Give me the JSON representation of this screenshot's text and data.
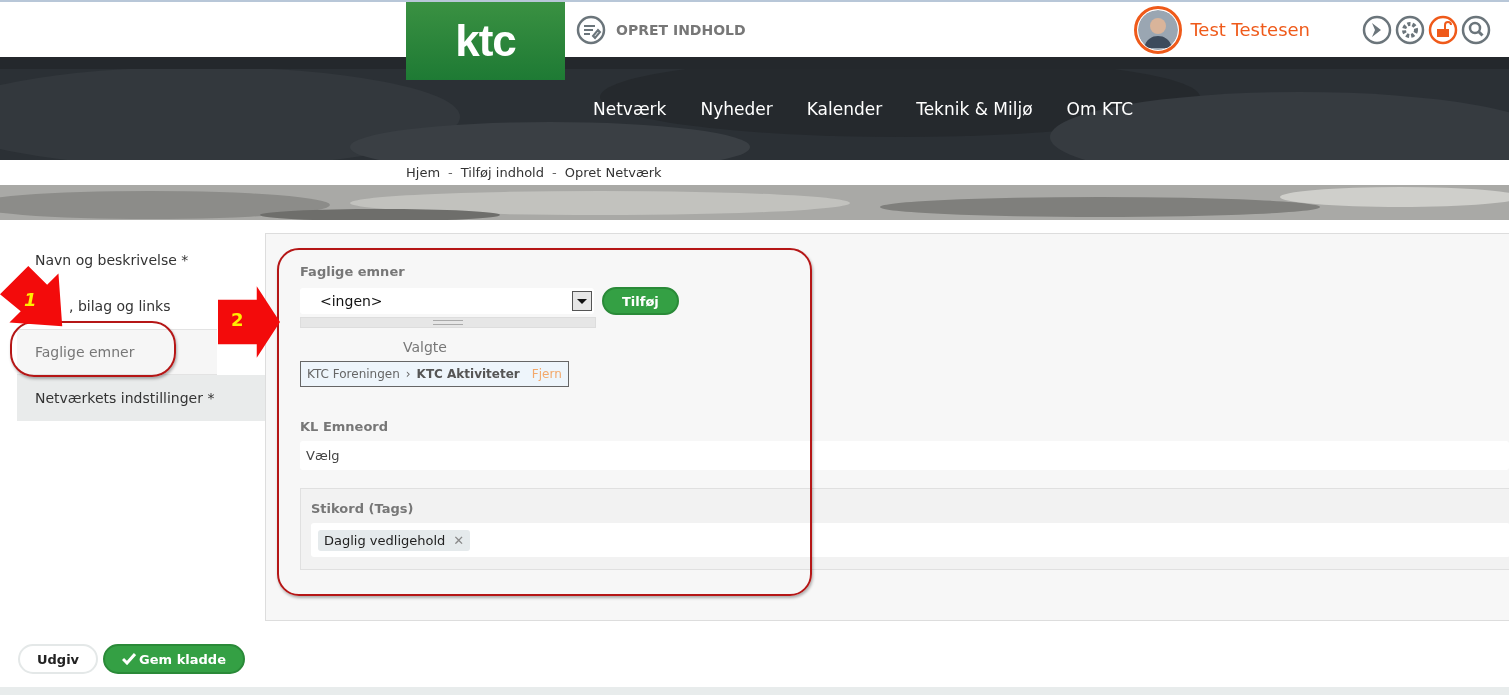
{
  "header": {
    "logo": "ktc",
    "create_link": "OPRET INDHOLD",
    "user_name": "Test Testesen"
  },
  "nav": [
    "Netværk",
    "Nyheder",
    "Kalender",
    "Teknik & Miljø",
    "Om KTC"
  ],
  "breadcrumb": [
    "Hjem",
    "Tilføj indhold",
    "Opret Netværk"
  ],
  "breadcrumb_separator": "-",
  "sidebar": [
    {
      "label": "Navn og beskrivelse *",
      "selected": false
    },
    {
      "label": ", bilag og links",
      "selected": false
    },
    {
      "label": "Faglige emner",
      "selected": true
    },
    {
      "label": "Netværkets indstillinger *",
      "selected": false
    }
  ],
  "subjects": {
    "title": "Faglige emner",
    "select_value": "<ingen>",
    "add_button": "Tilføj",
    "selected_title": "Valgte",
    "selected_items": [
      {
        "path": "KTC Foreningen",
        "separator": "›",
        "name": "KTC Aktiviteter",
        "remove": "Fjern"
      }
    ]
  },
  "kl_keywords": {
    "title": "KL Emneord",
    "placeholder": "Vælg"
  },
  "tags": {
    "title": "Stikord (Tags)",
    "items": [
      {
        "label": "Daglig vedligehold",
        "remove": "✕"
      }
    ]
  },
  "buttons": [
    {
      "label": "Udgiv",
      "kind": "plain"
    },
    {
      "label": "Gem kladde",
      "kind": "primary"
    }
  ],
  "annotations": [
    "1",
    "2"
  ]
}
